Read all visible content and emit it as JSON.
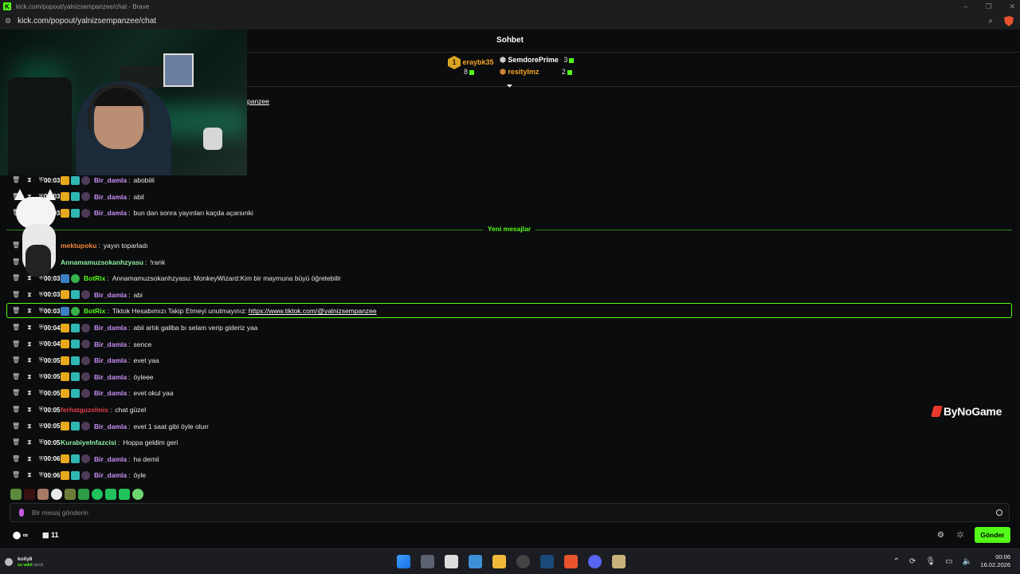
{
  "browser": {
    "title": "kick.com/popout/yalnizsempanzee/chat - Brave",
    "url": "kick.com/popout/yalnizsempanzee/chat"
  },
  "chat": {
    "header": "Sohbet",
    "leaderboard": {
      "first": {
        "rank": "1",
        "name": "eraybk35",
        "count": "8"
      },
      "second": {
        "name": "SemdorePrime",
        "count": "3"
      },
      "third": {
        "name": "resitylmz",
        "count": "2"
      }
    },
    "pinned_link_text": "panzee",
    "new_messages_label": "Yeni mesajlar",
    "messages_before": [
      {
        "time": "00:03",
        "user": "Bir_damla",
        "user_color": "#c98ff7",
        "badges": [
          "crown",
          "sub",
          "hero"
        ],
        "text": "abobiili"
      },
      {
        "time": "00:03",
        "user": "Bir_damla",
        "user_color": "#c98ff7",
        "badges": [
          "crown",
          "sub",
          "hero"
        ],
        "text": "abil"
      },
      {
        "time": "00:03",
        "user": "Bir_damla",
        "user_color": "#c98ff7",
        "badges": [
          "crown",
          "sub",
          "hero"
        ],
        "text": "bun dan sonra yayınları kaçda açarsınki"
      }
    ],
    "messages_after": [
      {
        "time": "03",
        "user": "mektupoku",
        "user_color": "#f2873a",
        "badges": [],
        "text": "yayın toparladı"
      },
      {
        "time": "03",
        "user": "Annamamuzsokanhzyasu",
        "user_color": "#8ff0a4",
        "badges": [],
        "text": "!rank"
      },
      {
        "time": "00:03",
        "user": "BotRix",
        "user_color": "#53fc18",
        "badges": [
          "bot",
          "verified"
        ],
        "text": "Annamamuzsokanhzyasu: MonkeyWizard:Kim bir maymuna büyü öğretebilir"
      },
      {
        "time": "00:03",
        "user": "Bir_damla",
        "user_color": "#c98ff7",
        "badges": [
          "crown",
          "sub",
          "hero"
        ],
        "text": "abi"
      },
      {
        "time": "00:03",
        "user": "BotRix",
        "user_color": "#53fc18",
        "badges": [
          "bot",
          "verified"
        ],
        "text": "Tiktok Hesabımızı Takip Etmeyi unutmayınız: ",
        "link": "https://www.tiktok.com/@yalnizsempanzee",
        "highlighted": true
      },
      {
        "time": "00:04",
        "user": "Bir_damla",
        "user_color": "#c98ff7",
        "badges": [
          "crown",
          "sub",
          "hero"
        ],
        "text": "abii artık galiba bı selam verip gideriz yaa"
      },
      {
        "time": "00:04",
        "user": "Bir_damla",
        "user_color": "#c98ff7",
        "badges": [
          "crown",
          "sub",
          "hero"
        ],
        "text": "sence"
      },
      {
        "time": "00:05",
        "user": "Bir_damla",
        "user_color": "#c98ff7",
        "badges": [
          "crown",
          "sub",
          "hero"
        ],
        "text": "evet yaa"
      },
      {
        "time": "00:05",
        "user": "Bir_damla",
        "user_color": "#c98ff7",
        "badges": [
          "crown",
          "sub",
          "hero"
        ],
        "text": "öyleee"
      },
      {
        "time": "00:05",
        "user": "Bir_damla",
        "user_color": "#c98ff7",
        "badges": [
          "crown",
          "sub",
          "hero"
        ],
        "text": "evet okul yaa"
      },
      {
        "time": "00:05",
        "user": "ferhatguzelmis",
        "user_color": "#e23c4c",
        "badges": [],
        "text": "chat güzel"
      },
      {
        "time": "00:05",
        "user": "Bir_damla",
        "user_color": "#c98ff7",
        "badges": [
          "crown",
          "sub",
          "hero"
        ],
        "text": "evet 1 saat gibi öyle olurr"
      },
      {
        "time": "00:05",
        "user": "KurabiyeInfazcisi",
        "user_color": "#8ff0a4",
        "badges": [],
        "text": "Hoppa geldim geri"
      },
      {
        "time": "00:06",
        "user": "Bir_damla",
        "user_color": "#c98ff7",
        "badges": [
          "crown",
          "sub",
          "hero"
        ],
        "text": "hə demii"
      },
      {
        "time": "00:06",
        "user": "Bir_damla",
        "user_color": "#c98ff7",
        "badges": [
          "crown",
          "sub",
          "hero"
        ],
        "text": "öyle"
      }
    ],
    "input_placeholder": "Bir mesaj gönderin",
    "points_symbol": "∞",
    "gift_count": "11",
    "send_label": "Gönder",
    "watermark": "ByNoGame"
  },
  "taskbar": {
    "user_name": "koily8",
    "user_status_green": "su vakti",
    "user_status_rest": "alındı",
    "time": "00:06",
    "date": "16.02.2026"
  },
  "colors": {
    "accent": "#53fc18",
    "background": "#0b0c0d"
  }
}
